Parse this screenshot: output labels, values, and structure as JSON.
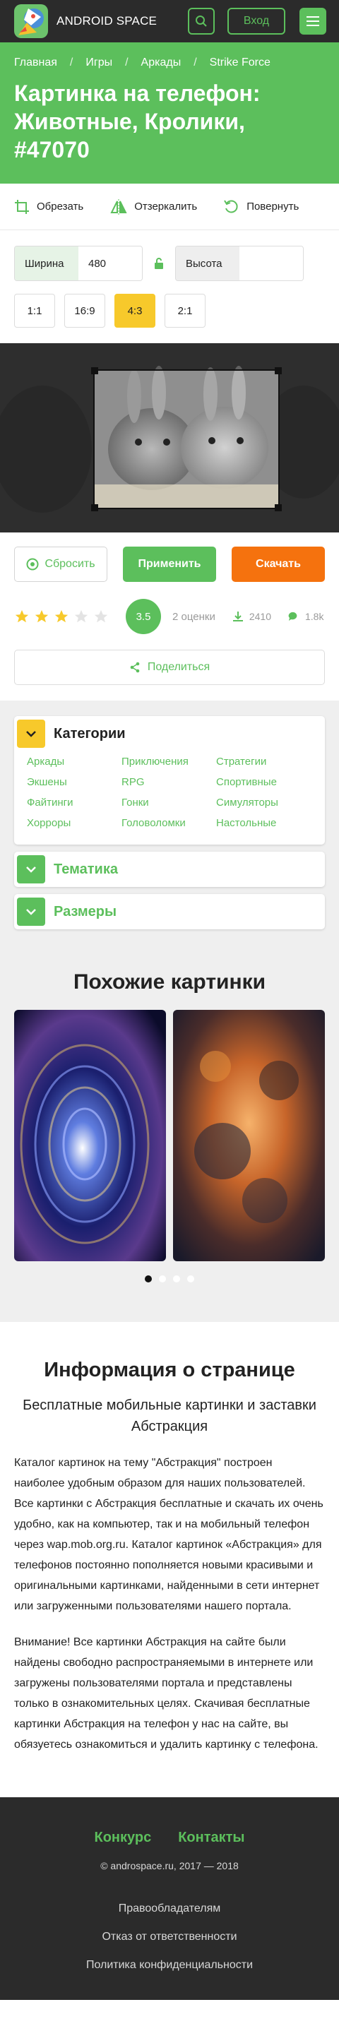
{
  "header": {
    "logo_text": "ANDROID SPACE",
    "login_label": "Вход"
  },
  "breadcrumb": [
    "Главная",
    "Игры",
    "Аркады",
    "Strike Force"
  ],
  "page_title": "Картинка на телефон: Животные, Кролики, #47070",
  "tools": {
    "crop": "Обрезать",
    "mirror": "Отзеркалить",
    "rotate": "Повернуть"
  },
  "dimensions": {
    "width_label": "Ширина",
    "width_value": "480",
    "height_label": "Высота",
    "height_value": ""
  },
  "ratios": [
    "1:1",
    "16:9",
    "4:3",
    "2:1"
  ],
  "active_ratio": "4:3",
  "buttons": {
    "reset": "Сбросить",
    "apply": "Применить",
    "download": "Скачать"
  },
  "rating": {
    "stars_filled": 3,
    "stars_total": 5,
    "score": "3.5",
    "votes": "2 оценки",
    "downloads": "2410",
    "comments": "1.8k"
  },
  "share_label": "Поделиться",
  "categories": {
    "title": "Категории",
    "items": [
      "Аркады",
      "Приключения",
      "Стратегии",
      "Экшены",
      "RPG",
      "Спортивные",
      "Файтинги",
      "Гонки",
      "Симуляторы",
      "Хорроры",
      "Головоломки",
      "Настольные"
    ]
  },
  "themes_title": "Тематика",
  "sizes_title": "Размеры",
  "similar_title": "Похожие картинки",
  "info": {
    "title": "Информация о странице",
    "subtitle": "Бесплатные мобильные картинки и заставки Абстракция",
    "paragraph1": "Каталог картинок на тему \"Абстракция\" построен наиболее удобным образом для наших пользователей. Все картинки с Абстракция бесплатные и скачать их очень удобно, как на компьютер, так и на мобильный телефон через wap.mob.org.ru. Каталог картинок «Абстракция» для телефонов постоянно пополняется новыми красивыми и оригинальными картинками, найденными в сети интернет или загруженными пользователями нашего портала.",
    "paragraph2": "Внимание! Все картинки Абстракция на сайте были найдены свободно распространяемыми в интернете или загружены пользователями портала и представлены только в ознакомительных целях. Скачивая бесплатные картинки Абстракция на телефон у нас на сайте, вы обязуетесь ознакомиться и удалить картинку с телефона."
  },
  "footer": {
    "contest": "Конкурс",
    "contacts": "Контакты",
    "copyright": "© androspace.ru, 2017 — 2018",
    "rights_holders": "Правообладателям",
    "disclaimer": "Отказ от ответственности",
    "privacy": "Политика конфиденциальности"
  },
  "colors": {
    "accent_green": "#5cbf5c",
    "download_orange": "#f5720e",
    "active_yellow": "#f7c92b",
    "dark": "#2b2b2b"
  }
}
